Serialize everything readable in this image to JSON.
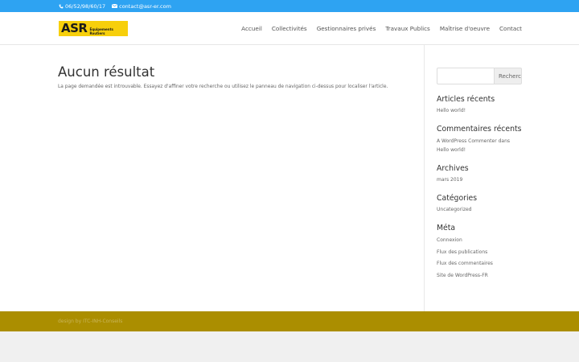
{
  "topbar": {
    "phone": "06/52/98/60/17",
    "email": "contact@asr-er.com"
  },
  "logo": {
    "big": "ASR",
    "small": "Équipements Routiers"
  },
  "nav": [
    "Accueil",
    "Collectivités",
    "Gestionnaires privés",
    "Travaux Publics",
    "Maîtrise d'oeuvre",
    "Contact"
  ],
  "content": {
    "title": "Aucun résultat",
    "message": "La page demandée est introuvable. Essayez d'affiner votre recherche ou utilisez le panneau de navigation ci-dessus pour localiser l'article."
  },
  "sidebar": {
    "search_button": "Rechercher",
    "recent_posts": {
      "title": "Articles récents",
      "items": [
        "Hello world!"
      ]
    },
    "recent_comments": {
      "title": "Commentaires récents",
      "items": [
        "A WordPress Commenter dans Hello world!"
      ]
    },
    "archives": {
      "title": "Archives",
      "items": [
        "mars 2019"
      ]
    },
    "categories": {
      "title": "Catégories",
      "items": [
        "Uncategorized"
      ]
    },
    "meta": {
      "title": "Méta",
      "items": [
        "Connexion",
        "Flux des publications",
        "Flux des commentaires",
        "Site de WordPress-FR"
      ]
    }
  },
  "footer": {
    "credit": "design by ITC-INH-Conseils"
  },
  "colors": {
    "topbar": "#2ea3f2",
    "logo": "#f7cf0b",
    "footer": "#ab8e00"
  }
}
